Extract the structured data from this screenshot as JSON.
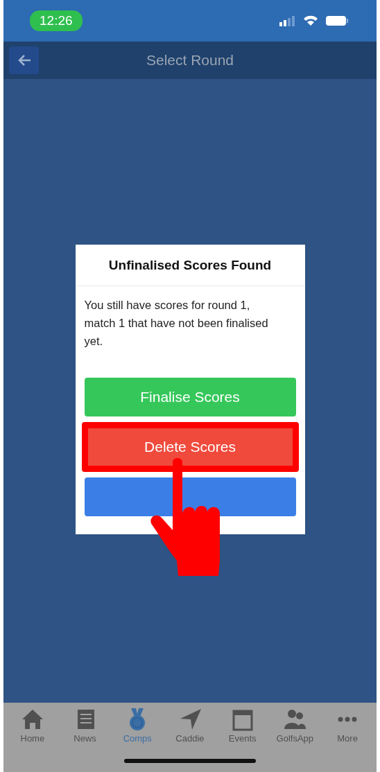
{
  "status_bar": {
    "time": "12:26"
  },
  "header": {
    "title": "Select Round"
  },
  "dialog": {
    "title": "Unfinalised Scores Found",
    "message": "You still have scores for round 1, match 1 that have not been finalised yet.",
    "buttons": [
      {
        "kind": "finalise",
        "label": "Finalise Scores",
        "highlighted": false
      },
      {
        "kind": "delete",
        "label": "Delete Scores",
        "highlighted": true
      },
      {
        "kind": "cancel"
      }
    ]
  },
  "tab_bar": [
    {
      "kind": "home",
      "label": "Home",
      "selected": false
    },
    {
      "kind": "news",
      "label": "News",
      "selected": false
    },
    {
      "kind": "comps",
      "label": "Comps",
      "selected": true
    },
    {
      "kind": "caddie",
      "label": "Caddie",
      "selected": false
    },
    {
      "kind": "events",
      "label": "Events",
      "selected": false
    },
    {
      "kind": "golfsapp",
      "label": "GolfsApp",
      "selected": false
    },
    {
      "kind": "more",
      "label": "More",
      "selected": false
    }
  ]
}
